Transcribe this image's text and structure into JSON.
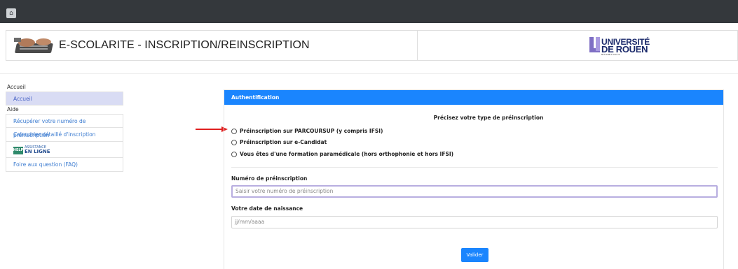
{
  "topbar": {
    "home_icon": "home-icon"
  },
  "header": {
    "title": "E-SCOLARITE - INSCRIPTION/REINSCRIPTION",
    "logo_top": "UNIVERSITÉ",
    "logo_bottom": "DE ROUEN",
    "logo_small": "NORMANDIE"
  },
  "sidebar": {
    "section_accueil": "Accueil",
    "item_accueil": "Accueil",
    "section_aide": "Aide",
    "items": [
      "Récupérer votre numéro de préinscription",
      "Calendrier détaillé d'inscription"
    ],
    "assist_box": "HELP",
    "assist_small": "ASSISTANCE",
    "assist_big": "EN LIGNE",
    "faq": "Foire aux question (FAQ)"
  },
  "panel": {
    "title": "Authentification",
    "subtitle": "Précisez votre type de préinscription",
    "options": [
      "Préinscription sur PARCOURSUP (y compris IFSI)",
      "Préinscription sur e-Candidat",
      "Vous êtes d'une formation paramédicale (hors orthophonie et hors IFSI)"
    ],
    "numero_label": "Numéro de préinscription",
    "numero_placeholder": "Saisir votre numéro de préinscription",
    "date_label": "Votre date de naissance",
    "date_placeholder": "jj/mm/aaaa",
    "submit_label": "Valider"
  },
  "colors": {
    "accent": "#1a85fe",
    "topbar": "#34383c",
    "active_bg": "#d9dcf4",
    "arrow": "#e02020"
  }
}
